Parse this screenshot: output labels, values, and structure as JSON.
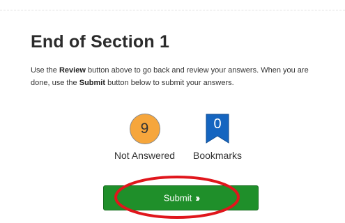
{
  "section": {
    "title": "End of Section 1",
    "instructions": {
      "part1": "Use the ",
      "review_word": "Review",
      "part2": " button above to go back and review your answers. When you are done, use the ",
      "submit_word": "Submit",
      "part3": " button below to submit your answers."
    }
  },
  "stats": {
    "not_answered": {
      "count": "9",
      "label": "Not Answered",
      "color": "#f6a63c"
    },
    "bookmarks": {
      "count": "0",
      "label": "Bookmarks",
      "color": "#1565c0"
    }
  },
  "submit_button": {
    "label": "Submit",
    "icon": "double-chevron-right-icon",
    "color": "#1f8f2a"
  },
  "annotation": {
    "shape": "oval",
    "color": "#e0161c"
  }
}
